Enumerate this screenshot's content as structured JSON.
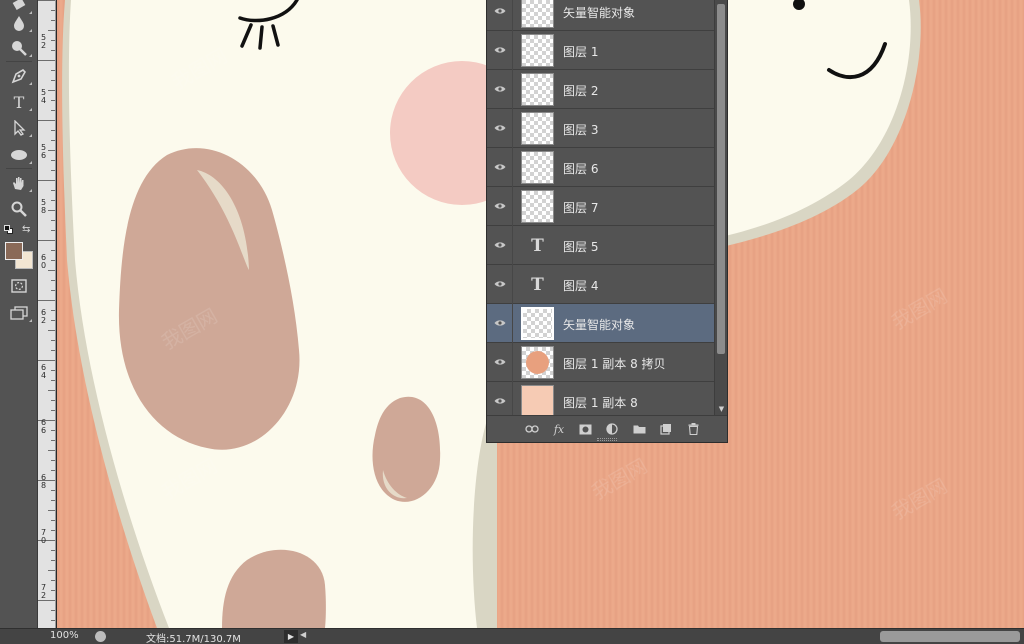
{
  "window": {
    "background": "#282828"
  },
  "toolbox": {
    "tools": [
      {
        "name": "eraser-tool"
      },
      {
        "name": "blur-tool"
      },
      {
        "name": "dodge-tool"
      },
      {
        "name": "pen-tool"
      },
      {
        "name": "type-tool"
      },
      {
        "name": "path-selection-tool"
      },
      {
        "name": "ellipse-tool"
      },
      {
        "name": "hand-tool"
      },
      {
        "name": "zoom-tool"
      }
    ],
    "foreground_color": "#8a6a58",
    "background_color": "#f3e6d3"
  },
  "ruler": {
    "labels": [
      "52",
      "54",
      "56",
      "58",
      "60",
      "62",
      "64",
      "66",
      "68",
      "70",
      "72"
    ]
  },
  "canvas": {
    "background": "#eaa687",
    "character_color": "#fcfaed",
    "spot_color": "#cfa897",
    "cheek_color": "#f4cbc3",
    "outline_color": "#d9d6c4"
  },
  "layers_panel": {
    "layers": [
      {
        "name": "矢量智能对象",
        "kind": "smart",
        "selected": false
      },
      {
        "name": "图层 1",
        "kind": "raster",
        "selected": false
      },
      {
        "name": "图层 2",
        "kind": "raster",
        "selected": false
      },
      {
        "name": "图层 3",
        "kind": "raster",
        "selected": false
      },
      {
        "name": "图层 6",
        "kind": "raster",
        "selected": false
      },
      {
        "name": "图层 7",
        "kind": "raster",
        "selected": false
      },
      {
        "name": "图层 5",
        "kind": "text",
        "selected": false
      },
      {
        "name": "图层 4",
        "kind": "text",
        "selected": false
      },
      {
        "name": "矢量智能对象",
        "kind": "smart",
        "selected": true
      },
      {
        "name": "图层 1 副本 8 拷贝",
        "kind": "raster-orange",
        "selected": false
      },
      {
        "name": "图层 1 副本 8",
        "kind": "raster-peach",
        "selected": false
      }
    ],
    "text_thumb_glyph": "T",
    "footer_buttons": [
      "link-layers",
      "add-layer-style",
      "add-mask",
      "new-adjustment",
      "new-group",
      "new-layer",
      "delete-layer"
    ],
    "fx_label": "fx",
    "selected_color": "#5c6b80"
  },
  "statusbar": {
    "zoom": "100%",
    "doc_info": "文档:51.7M/130.7M",
    "arrow": "▶",
    "left_arrow": "◀"
  }
}
